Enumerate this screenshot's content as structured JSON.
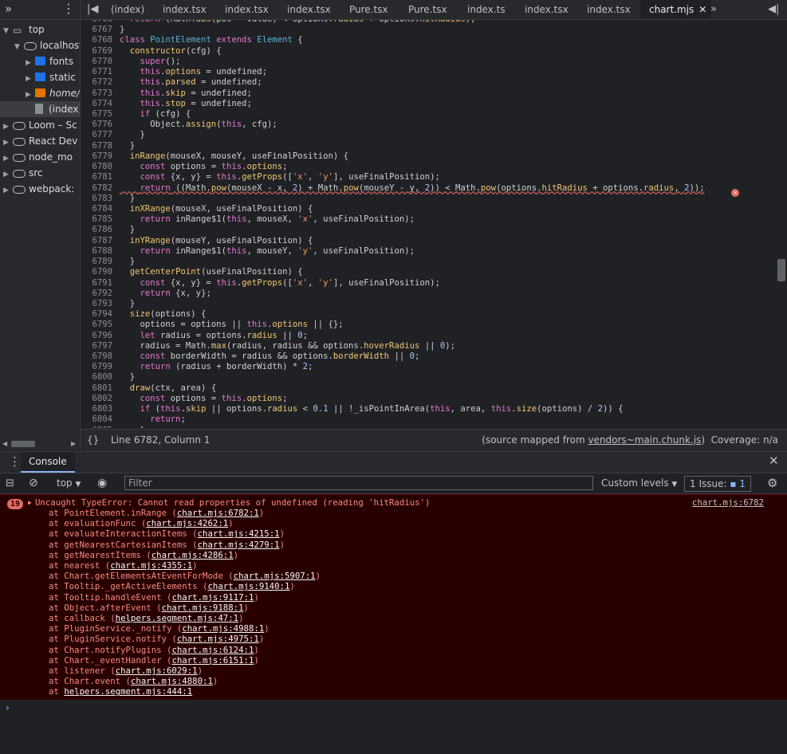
{
  "sidebar": {
    "items": [
      {
        "label": "top",
        "depth": 0,
        "icon": "frame-icon",
        "expanded": true
      },
      {
        "label": "localhost:",
        "depth": 1,
        "icon": "cloud-icon",
        "expanded": true
      },
      {
        "label": "fonts",
        "depth": 2,
        "icon": "folder-icon"
      },
      {
        "label": "static",
        "depth": 2,
        "icon": "folder-icon"
      },
      {
        "label": "home/i",
        "depth": 2,
        "icon": "folder-orange-icon",
        "italic": true
      },
      {
        "label": "(index)",
        "depth": 2,
        "icon": "file-icon",
        "selected": true
      },
      {
        "label": "Loom – Sc",
        "depth": 0,
        "icon": "cloud-icon"
      },
      {
        "label": "React Dev",
        "depth": 0,
        "icon": "cloud-icon"
      },
      {
        "label": "node_mo",
        "depth": 0,
        "icon": "cloud-icon"
      },
      {
        "label": "src",
        "depth": 0,
        "icon": "cloud-icon"
      },
      {
        "label": "webpack:",
        "depth": 0,
        "icon": "cloud-icon"
      }
    ]
  },
  "tabs": [
    {
      "label": "(index)"
    },
    {
      "label": "index.tsx"
    },
    {
      "label": "index.tsx"
    },
    {
      "label": "index.tsx"
    },
    {
      "label": "Pure.tsx"
    },
    {
      "label": "Pure.tsx"
    },
    {
      "label": "index.ts"
    },
    {
      "label": "index.tsx"
    },
    {
      "label": "index.tsx"
    },
    {
      "label": "chart.mjs",
      "active": true
    }
  ],
  "code": {
    "lines": [
      {
        "n": "6766",
        "html": "  <span class='kw'>return</span> (Math.<span class='fn'>abs</span>(pos - value) &lt; options.<span class='prop'>radius</span> + options.<span class='prop'>hitRadius</span>);"
      },
      {
        "n": "6767",
        "html": "}"
      },
      {
        "n": "6768",
        "html": "<span class='kw'>class</span> <span class='cls'>PointElement</span> <span class='kw'>extends</span> <span class='cls'>Element</span> {"
      },
      {
        "n": "6769",
        "html": "  <span class='fn'>constructor</span>(cfg) {"
      },
      {
        "n": "6770",
        "html": "    <span class='kw'>super</span>();"
      },
      {
        "n": "6771",
        "html": "    <span class='th'>this</span>.<span class='prop'>options</span> = undefined;"
      },
      {
        "n": "6772",
        "html": "    <span class='th'>this</span>.<span class='prop'>parsed</span> = undefined;"
      },
      {
        "n": "6773",
        "html": "    <span class='th'>this</span>.<span class='prop'>skip</span> = undefined;"
      },
      {
        "n": "6774",
        "html": "    <span class='th'>this</span>.<span class='prop'>stop</span> = undefined;"
      },
      {
        "n": "6775",
        "html": "    <span class='kw'>if</span> (cfg) {"
      },
      {
        "n": "6776",
        "html": "      Object.<span class='fn'>assign</span>(<span class='th'>this</span>, cfg);"
      },
      {
        "n": "6777",
        "html": "    }"
      },
      {
        "n": "6778",
        "html": "  }"
      },
      {
        "n": "6779",
        "html": "  <span class='fn'>inRange</span>(mouseX, mouseY, useFinalPosition) {"
      },
      {
        "n": "6780",
        "html": "    <span class='kw'>const</span> options = <span class='th'>this</span>.<span class='prop'>options</span>;"
      },
      {
        "n": "6781",
        "html": "    <span class='kw'>const</span> {x, y} = <span class='th'>this</span>.<span class='fn'>getProps</span>([<span class='str'>'x'</span>, <span class='str'>'y'</span>], useFinalPosition);"
      },
      {
        "n": "6782",
        "html": "    <span class='kw'>return</span> ((Math.<span class='fn'>pow</span>(mouseX - x, <span class='num'>2</span>) + Math.<span class='fn'>pow</span>(mouseY - y, <span class='num'>2</span>)) &lt; Math.<span class='fn'>pow</span>(options.<span class='prop'>hitRadius</span> + options.<span class='prop'>radius</span>, <span class='num'>2</span>));",
        "error": true
      },
      {
        "n": "6783",
        "html": "  }"
      },
      {
        "n": "6784",
        "html": "  <span class='fn'>inXRange</span>(mouseX, useFinalPosition) {"
      },
      {
        "n": "6785",
        "html": "    <span class='kw'>return</span> inRange$1(<span class='th'>this</span>, mouseX, <span class='str'>'x'</span>, useFinalPosition);"
      },
      {
        "n": "6786",
        "html": "  }"
      },
      {
        "n": "6787",
        "html": "  <span class='fn'>inYRange</span>(mouseY, useFinalPosition) {"
      },
      {
        "n": "6788",
        "html": "    <span class='kw'>return</span> inRange$1(<span class='th'>this</span>, mouseY, <span class='str'>'y'</span>, useFinalPosition);"
      },
      {
        "n": "6789",
        "html": "  }"
      },
      {
        "n": "6790",
        "html": "  <span class='fn'>getCenterPoint</span>(useFinalPosition) {"
      },
      {
        "n": "6791",
        "html": "    <span class='kw'>const</span> {x, y} = <span class='th'>this</span>.<span class='fn'>getProps</span>([<span class='str'>'x'</span>, <span class='str'>'y'</span>], useFinalPosition);"
      },
      {
        "n": "6792",
        "html": "    <span class='kw'>return</span> {x, y};"
      },
      {
        "n": "6793",
        "html": "  }"
      },
      {
        "n": "6794",
        "html": "  <span class='fn'>size</span>(options) {"
      },
      {
        "n": "6795",
        "html": "    options = options || <span class='th'>this</span>.<span class='prop'>options</span> || {};"
      },
      {
        "n": "6796",
        "html": "    <span class='kw'>let</span> radius = options.<span class='prop'>radius</span> || <span class='num'>0</span>;"
      },
      {
        "n": "6797",
        "html": "    radius = Math.<span class='fn'>max</span>(radius, radius &amp;&amp; options.<span class='prop'>hoverRadius</span> || <span class='num'>0</span>);"
      },
      {
        "n": "6798",
        "html": "    <span class='kw'>const</span> borderWidth = radius &amp;&amp; options.<span class='prop'>borderWidth</span> || <span class='num'>0</span>;"
      },
      {
        "n": "6799",
        "html": "    <span class='kw'>return</span> (radius + borderWidth) * <span class='num'>2</span>;"
      },
      {
        "n": "6800",
        "html": "  }"
      },
      {
        "n": "6801",
        "html": "  <span class='fn'>draw</span>(ctx, area) {"
      },
      {
        "n": "6802",
        "html": "    <span class='kw'>const</span> options = <span class='th'>this</span>.<span class='prop'>options</span>;"
      },
      {
        "n": "6803",
        "html": "    <span class='kw'>if</span> (<span class='th'>this</span>.<span class='prop'>skip</span> || options.<span class='prop'>radius</span> &lt; <span class='num'>0.1</span> || !_isPointInArea(<span class='th'>this</span>, area, <span class='th'>this</span>.<span class='fn'>size</span>(options) / <span class='num'>2</span>)) {"
      },
      {
        "n": "6804",
        "html": "      <span class='kw'>return</span>;"
      },
      {
        "n": "6805",
        "html": "    }"
      }
    ]
  },
  "status": {
    "braces": "{}",
    "position": "Line 6782, Column 1",
    "source_prefix": "(source mapped from ",
    "source_file": "vendors~main.chunk.js",
    "source_suffix": ")",
    "coverage": "Coverage: n/a"
  },
  "console": {
    "tab_label": "Console",
    "context": "top",
    "filter_placeholder": "Filter",
    "levels_label": "Custom levels",
    "issues_label": "1 Issue:",
    "issues_count": "1",
    "error": {
      "count": "19",
      "message": "Uncaught TypeError: Cannot read properties of undefined (reading 'hitRadius')",
      "location": "chart.mjs:6782",
      "stack": [
        {
          "fn": "at PointElement.inRange (",
          "loc": "chart.mjs:6782:1",
          "end": ")"
        },
        {
          "fn": "at evaluationFunc (",
          "loc": "chart.mjs:4262:1",
          "end": ")"
        },
        {
          "fn": "at evaluateInteractionItems (",
          "loc": "chart.mjs:4215:1",
          "end": ")"
        },
        {
          "fn": "at getNearestCartesianItems (",
          "loc": "chart.mjs:4279:1",
          "end": ")"
        },
        {
          "fn": "at getNearestItems (",
          "loc": "chart.mjs:4286:1",
          "end": ")"
        },
        {
          "fn": "at nearest (",
          "loc": "chart.mjs:4355:1",
          "end": ")"
        },
        {
          "fn": "at Chart.getElementsAtEventForMode (",
          "loc": "chart.mjs:5907:1",
          "end": ")"
        },
        {
          "fn": "at Tooltip._getActiveElements (",
          "loc": "chart.mjs:9140:1",
          "end": ")"
        },
        {
          "fn": "at Tooltip.handleEvent (",
          "loc": "chart.mjs:9117:1",
          "end": ")"
        },
        {
          "fn": "at Object.afterEvent (",
          "loc": "chart.mjs:9188:1",
          "end": ")"
        },
        {
          "fn": "at callback (",
          "loc": "helpers.segment.mjs:47:1",
          "end": ")"
        },
        {
          "fn": "at PluginService._notify (",
          "loc": "chart.mjs:4988:1",
          "end": ")"
        },
        {
          "fn": "at PluginService.notify (",
          "loc": "chart.mjs:4975:1",
          "end": ")"
        },
        {
          "fn": "at Chart.notifyPlugins (",
          "loc": "chart.mjs:6124:1",
          "end": ")"
        },
        {
          "fn": "at Chart._eventHandler (",
          "loc": "chart.mjs:6151:1",
          "end": ")"
        },
        {
          "fn": "at listener (",
          "loc": "chart.mjs:6029:1",
          "end": ")"
        },
        {
          "fn": "at Chart.event (",
          "loc": "chart.mjs:4880:1",
          "end": ")"
        },
        {
          "fn": "at ",
          "loc": "helpers.segment.mjs:444:1",
          "end": ""
        }
      ]
    },
    "prompt": "›"
  },
  "colors": {
    "background": "#202124",
    "panel": "#28292c",
    "error_bg": "#290000",
    "error_text": "#f28b82",
    "accent": "#8ab4f8"
  }
}
